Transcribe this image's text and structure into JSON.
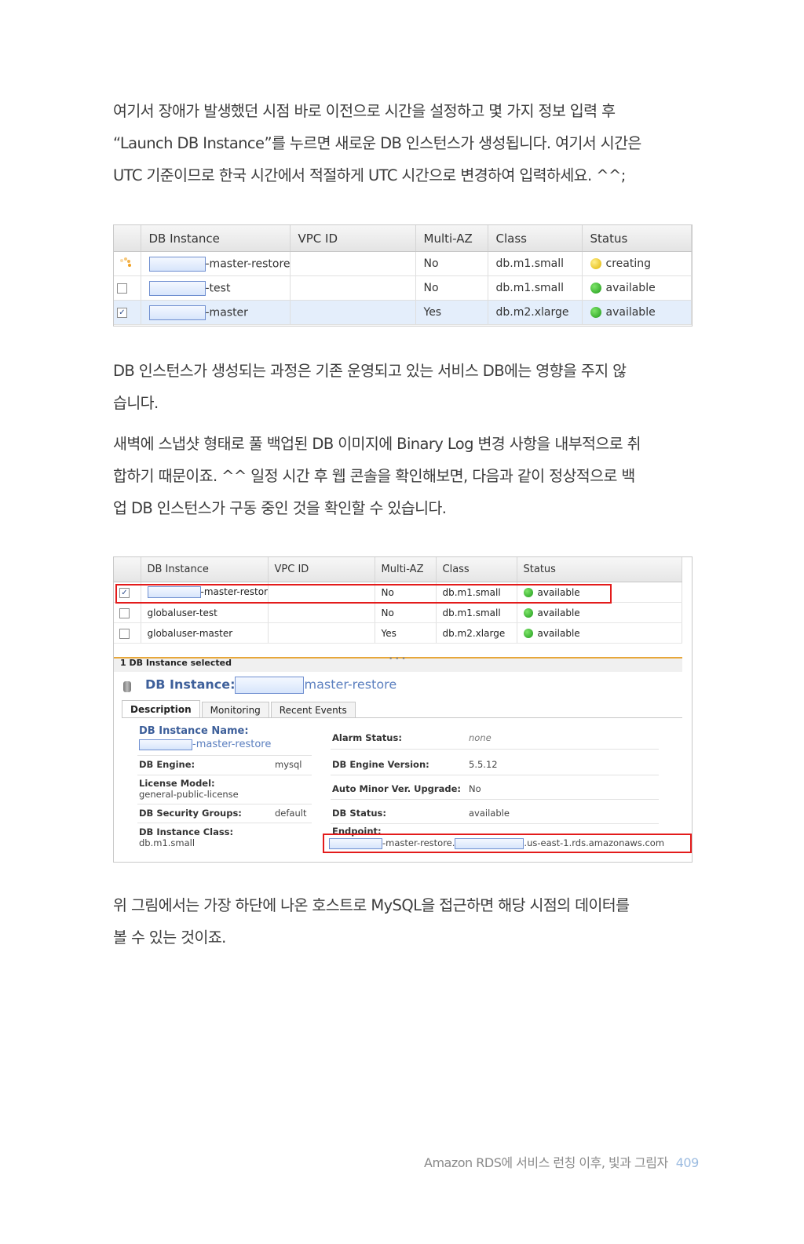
{
  "paragraphs": {
    "p1": [
      "여기서 장애가 발생했던 시점 바로 이전으로 시간을 설정하고 몇 가지 정보 입력 후",
      "“Launch DB Instance”를 누르면 새로운 DB 인스턴스가 생성됩니다. 여기서 시간은",
      "UTC 기준이므로 한국 시간에서 적절하게 UTC 시간으로 변경하여 입력하세요. ^^;"
    ],
    "p2": [
      "DB 인스턴스가 생성되는 과정은 기존 운영되고 있는 서비스 DB에는 영향을 주지 않",
      "습니다."
    ],
    "p3": [
      "새벽에 스냅샷 형태로 풀 백업된 DB 이미지에 Binary Log 변경 사항을 내부적으로 취",
      "합하기 때문이죠. ^^ 일정 시간 후 웹 콘솔을 확인해보면, 다음과 같이 정상적으로 백",
      "업 DB 인스턴스가 구동 중인 것을 확인할 수 있습니다."
    ],
    "p4": [
      "위 그림에서는 가장 하단에 나온 호스트로 MySQL을 접근하면 해당 시점의 데이터를",
      "볼 수 있는 것이죠."
    ]
  },
  "table1": {
    "headers": [
      "DB Instance",
      "VPC ID",
      "Multi-AZ",
      "Class",
      "Status"
    ],
    "rows": [
      {
        "name": "-master-restore",
        "vpc": "",
        "multiaz": "No",
        "class": "db.m1.small",
        "status": "creating"
      },
      {
        "name": "-test",
        "vpc": "",
        "multiaz": "No",
        "class": "db.m1.small",
        "status": "available"
      },
      {
        "name": "-master",
        "vpc": "",
        "multiaz": "Yes",
        "class": "db.m2.xlarge",
        "status": "available"
      }
    ]
  },
  "table2": {
    "headers": [
      "DB Instance",
      "VPC ID",
      "Multi-AZ",
      "Class",
      "Status"
    ],
    "rows": [
      {
        "name": "-master-restore",
        "vpc": "",
        "multiaz": "No",
        "class": "db.m1.small",
        "status": "available"
      },
      {
        "name": "globaluser-test",
        "vpc": "",
        "multiaz": "No",
        "class": "db.m1.small",
        "status": "available"
      },
      {
        "name": "globaluser-master",
        "vpc": "",
        "multiaz": "Yes",
        "class": "db.m2.xlarge",
        "status": "available"
      }
    ]
  },
  "detail": {
    "selected_count": "1 DB Instance selected",
    "title_label": "DB Instance:",
    "title_suffix": "master-restore",
    "tabs": [
      "Description",
      "Monitoring",
      "Recent Events"
    ],
    "instance_name_label": "DB Instance Name:",
    "instance_name_value": "-master-restore",
    "engine_label": "DB Engine:",
    "engine_value": "mysql",
    "license_label": "License Model:",
    "license_value": "general-public-license",
    "secgroups_label": "DB Security Groups:",
    "secgroups_value": "default",
    "class_label": "DB Instance Class:",
    "class_value": "db.m1.small",
    "alarm_label": "Alarm Status:",
    "alarm_value": "none",
    "engine_version_label": "DB Engine Version:",
    "engine_version_value": "5.5.12",
    "auto_minor_label": "Auto Minor Ver. Upgrade:",
    "auto_minor_value": "No",
    "db_status_label": "DB Status:",
    "db_status_value": "available",
    "endpoint_label": "Endpoint:",
    "endpoint_mid": "-master-restore.",
    "endpoint_tail": ".us-east-1.rds.amazonaws.com"
  },
  "footer": {
    "text": "Amazon RDS에 서비스 런칭 이후, 빛과 그림자",
    "page": "409"
  },
  "colors": {
    "highlight_red": "#e31b1b",
    "available_green": "#1f9a1a",
    "creating_yellow": "#e0b400",
    "page_number_blue": "#9bbbe0"
  }
}
